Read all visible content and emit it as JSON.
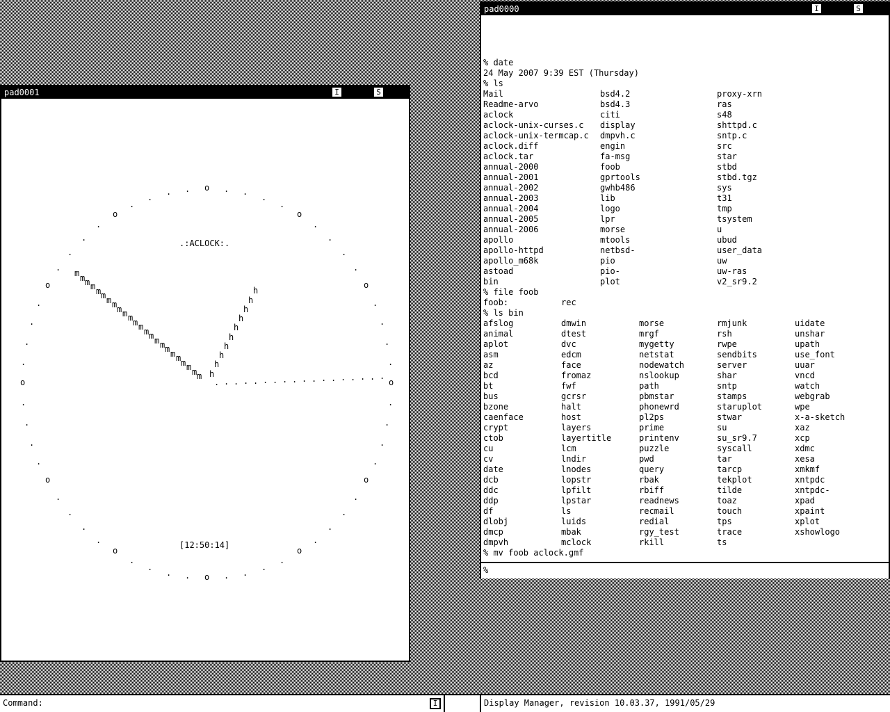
{
  "pad_right": {
    "title": "pad0000",
    "btn_i": "I",
    "btn_s": "S",
    "lines": [
      "% date",
      "24 May 2007 9:39 EST (Thursday)",
      "% ls"
    ],
    "ls_cols": [
      [
        "Mail",
        "Readme-arvo",
        "aclock",
        "aclock-unix-curses.c",
        "aclock-unix-termcap.c",
        "aclock.diff",
        "aclock.tar",
        "annual-2000",
        "annual-2001",
        "annual-2002",
        "annual-2003",
        "annual-2004",
        "annual-2005",
        "annual-2006",
        "apollo",
        "apollo-httpd",
        "apollo_m68k",
        "astoad",
        "bin"
      ],
      [
        "bsd4.2",
        "bsd4.3",
        "citi",
        "display",
        "dmpvh.c",
        "engin",
        "fa-msg",
        "foob",
        "gprtools",
        "gwhb486",
        "lib",
        "logo",
        "lpr",
        "morse",
        "mtools",
        "netbsd-",
        "pio",
        "pio-",
        "plot"
      ],
      [
        "proxy-xrn",
        "ras",
        "s48",
        "shttpd.c",
        "sntp.c",
        "src",
        "star",
        "stbd",
        "stbd.tgz",
        "sys",
        "t31",
        "tmp",
        "tsystem",
        "u",
        "ubud",
        "user_data",
        "uw",
        "uw-ras",
        "v2_sr9.2"
      ]
    ],
    "file_cmd": "% file foob",
    "file_result_name": "foob:",
    "file_result_type": "rec",
    "lsbin_cmd": "% ls bin",
    "bin_cols": [
      [
        "afslog",
        "animal",
        "aplot",
        "asm",
        "az",
        "bcd",
        "bt",
        "bus",
        "bzone",
        "caenface",
        "crypt",
        "ctob",
        "cu",
        "cv",
        "date",
        "dcb",
        "ddc",
        "ddp",
        "df",
        "dlobj",
        "dmcp",
        "dmpvh"
      ],
      [
        "dmwin",
        "dtest",
        "dvc",
        "edcm",
        "face",
        "fromaz",
        "fwf",
        "gcrsr",
        "halt",
        "host",
        "layers",
        "layertitle",
        "lcm",
        "lndir",
        "lnodes",
        "lopstr",
        "lpfilt",
        "lpstar",
        "ls",
        "luids",
        "mbak",
        "mclock"
      ],
      [
        "morse",
        "mrgf",
        "mygetty",
        "netstat",
        "nodewatch",
        "nslookup",
        "path",
        "pbmstar",
        "phonewrd",
        "pl2ps",
        "prime",
        "printenv",
        "puzzle",
        "pwd",
        "query",
        "rbak",
        "rbiff",
        "readnews",
        "recmail",
        "redial",
        "rgy_test",
        "rkill"
      ],
      [
        "rmjunk",
        "rsh",
        "rwpe",
        "sendbits",
        "server",
        "shar",
        "sntp",
        "stamps",
        "staruplot",
        "stwar",
        "su",
        "su_sr9.7",
        "syscall",
        "tar",
        "tarcp",
        "tekplot",
        "tilde",
        "toaz",
        "touch",
        "tps",
        "trace",
        "ts"
      ],
      [
        "uidate",
        "unshar",
        "upath",
        "use_font",
        "uuar",
        "vncd",
        "watch",
        "webgrab",
        "wpe",
        "x-a-sketch",
        "xaz",
        "xcp",
        "xdmc",
        "xesa",
        "xmkmf",
        "xntpdc",
        "xntpdc-",
        "xpad",
        "xpaint",
        "xplot",
        "xshowlogo"
      ]
    ],
    "mv_cmd": "% mv foob aclock.gmf",
    "input_prompt": "%"
  },
  "pad_left": {
    "title": "pad0001",
    "btn_i": "I",
    "btn_s": "S",
    "clock_label": ".:ACLOCK:.",
    "clock_time": "[12:50:14]",
    "minute_hand_glyph": "m",
    "hour_hand_glyph": "h",
    "second_hand_glyph": "."
  },
  "statusbar": {
    "command_label": "Command:",
    "command_btn": "I",
    "dm_info": "Display Manager, revision 10.03.37, 1991/05/29"
  }
}
